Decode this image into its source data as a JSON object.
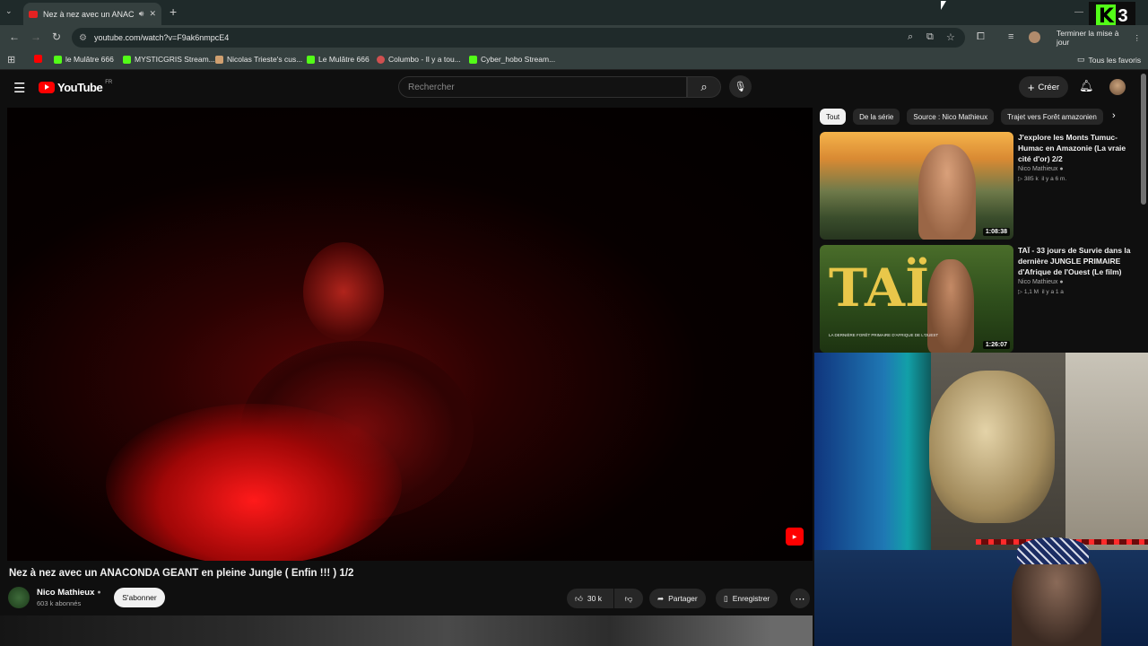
{
  "browser": {
    "tab_title": "Nez à nez avec un ANACONDA",
    "url": "youtube.com/watch?v=F9ak6nmpcE4",
    "update_button": "Terminer la mise à jour",
    "all_bookmarks": "Tous les favoris",
    "bookmarks": [
      {
        "label": "",
        "color": "#ff0000"
      },
      {
        "label": "le Mulâtre 666",
        "color": "#53fc18"
      },
      {
        "label": "MYSTICGRIS Stream...",
        "color": "#53fc18"
      },
      {
        "label": "Nicolas Trieste's cus...",
        "color": "#d0a070"
      },
      {
        "label": "Le Mulâtre 666",
        "color": "#53fc18"
      },
      {
        "label": "Columbo - Il y a tou...",
        "color": "#d05050"
      },
      {
        "label": "Cyber_hobo Stream...",
        "color": "#53fc18"
      }
    ],
    "kick_badge": {
      "letter": "K",
      "number": "3",
      "color": "#53fc18"
    }
  },
  "youtube": {
    "logo_text": "YouTube",
    "region": "FR",
    "search_placeholder": "Rechercher",
    "create_label": "Créer",
    "video": {
      "title": "Nez à nez avec un ANACONDA GEANT en pleine Jungle ( Enfin !!! ) 1/2",
      "channel": "Nico Mathieux",
      "subscribers": "603 k abonnés",
      "subscribe_label": "S'abonner",
      "likes": "30 k",
      "share_label": "Partager",
      "save_label": "Enregistrer"
    },
    "chips": [
      {
        "label": "Tout",
        "active": true
      },
      {
        "label": "De la série",
        "active": false
      },
      {
        "label": "Source : Nico Mathieux",
        "active": false
      },
      {
        "label": "Trajet vers Forêt amazonien",
        "active": false
      }
    ],
    "recommendations": [
      {
        "title": "J'explore les Monts Tumuc-Humac en Amazonie (La vraie cité d'or) 2/2",
        "channel": "Nico Mathieux",
        "views": "385 k",
        "age": "il y a 6 m.",
        "duration": "1:08:38"
      },
      {
        "title": "TAÏ - 33 jours de Survie dans la dernière JUNGLE PRIMAIRE d'Afrique de l'Ouest (Le film)",
        "channel": "Nico Mathieux",
        "views": "1,1 M",
        "age": "il y a 1 a",
        "duration": "1:26:07",
        "thumb_text": "TAÏ",
        "thumb_caption": "LA DERNIÈRE FORÊT PRIMAIRE D'AFRIQUE DE L'OUEST"
      }
    ]
  }
}
